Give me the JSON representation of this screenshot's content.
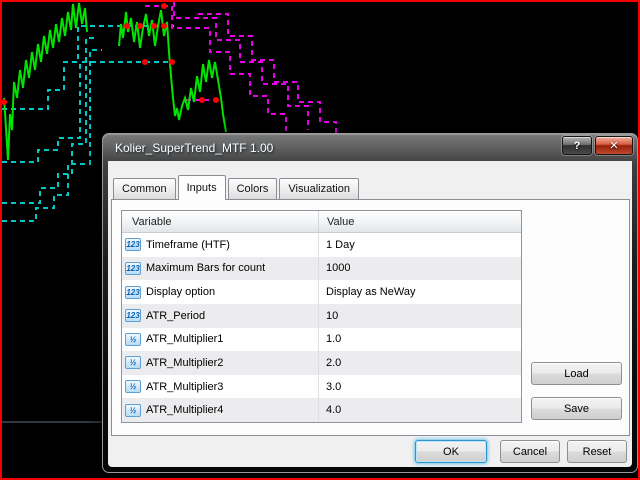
{
  "window": {
    "title": "Kolier_SuperTrend_MTF 1.00",
    "help_button": "?",
    "close_button": "✕"
  },
  "tabs": [
    {
      "label": "Common",
      "active": false
    },
    {
      "label": "Inputs",
      "active": true
    },
    {
      "label": "Colors",
      "active": false
    },
    {
      "label": "Visualization",
      "active": false
    }
  ],
  "table": {
    "headers": {
      "variable": "Variable",
      "value": "Value"
    },
    "rows": [
      {
        "icon": "123",
        "type": "integer",
        "variable": "Timeframe (HTF)",
        "value": "1 Day"
      },
      {
        "icon": "123",
        "type": "integer",
        "variable": "Maximum Bars for count",
        "value": "1000"
      },
      {
        "icon": "123",
        "type": "integer",
        "variable": "Display option",
        "value": "Display as NeWay"
      },
      {
        "icon": "123",
        "type": "integer",
        "variable": "ATR_Period",
        "value": "10"
      },
      {
        "icon": "½",
        "type": "double",
        "variable": "ATR_Multiplier1",
        "value": "1.0"
      },
      {
        "icon": "½",
        "type": "double",
        "variable": "ATR_Multiplier2",
        "value": "2.0"
      },
      {
        "icon": "½",
        "type": "double",
        "variable": "ATR_Multiplier3",
        "value": "3.0"
      },
      {
        "icon": "½",
        "type": "double",
        "variable": "ATR_Multiplier4",
        "value": "4.0"
      }
    ]
  },
  "buttons": {
    "load": "Load",
    "save": "Save",
    "ok": "OK",
    "cancel": "Cancel",
    "reset": "Reset"
  },
  "chart": {
    "background": "#000000",
    "frame_color": "#f50000",
    "price_color": "#00e400",
    "uptrend_color": "#00c8c8",
    "downtrend_color": "#e600e6",
    "signal_dot_color": "#ff0000",
    "separator_color": "#5c7188"
  }
}
